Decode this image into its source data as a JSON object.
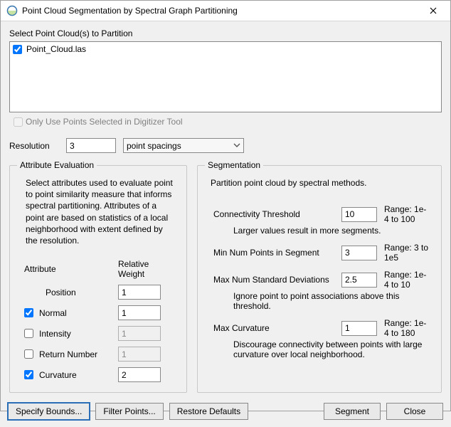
{
  "title": "Point Cloud Segmentation by Spectral Graph Partitioning",
  "select_label": "Select Point Cloud(s) to Partition",
  "clouds": [
    {
      "name": "Point_Cloud.las",
      "checked": true
    }
  ],
  "only_selected": {
    "label": "Only Use Points Selected in Digitizer Tool",
    "checked": false
  },
  "resolution": {
    "label": "Resolution",
    "value": "3",
    "unit_selected": "point spacings"
  },
  "attr_eval": {
    "legend": "Attribute Evaluation",
    "desc": "Select attributes used to evaluate point to point similarity measure that informs spectral partitioning. Attributes of a point are based on statistics of a local neighborhood with extent defined by the resolution.",
    "col_attr": "Attribute",
    "col_wt": "Relative Weight",
    "rows": [
      {
        "label": "Position",
        "has_box": false,
        "checked": true,
        "weight": "1",
        "enabled": true
      },
      {
        "label": "Normal",
        "has_box": true,
        "checked": true,
        "weight": "1",
        "enabled": true
      },
      {
        "label": "Intensity",
        "has_box": true,
        "checked": false,
        "weight": "1",
        "enabled": false
      },
      {
        "label": "Return Number",
        "has_box": true,
        "checked": false,
        "weight": "1",
        "enabled": false
      },
      {
        "label": "Curvature",
        "has_box": true,
        "checked": true,
        "weight": "2",
        "enabled": true
      }
    ]
  },
  "seg": {
    "legend": "Segmentation",
    "desc": "Partition point cloud by spectral methods.",
    "params": {
      "conn": {
        "label": "Connectivity Threshold",
        "value": "10",
        "range": "Range: 1e-4 to 100",
        "hint": "Larger values result in more segments."
      },
      "minpts": {
        "label": "Min Num Points in Segment",
        "value": "3",
        "range": "Range: 3 to 1e5"
      },
      "maxstd": {
        "label": "Max Num Standard Deviations",
        "value": "2.5",
        "range": "Range: 1e-4 to 10",
        "hint": "Ignore point to point associations above this threshold."
      },
      "maxcurv": {
        "label": "Max Curvature",
        "value": "1",
        "range": "Range: 1e-4 to 180",
        "hint": "Discourage connectivity between points with large curvature over local neighborhood."
      }
    }
  },
  "buttons": {
    "bounds": "Specify Bounds...",
    "filter": "Filter Points...",
    "restore": "Restore Defaults",
    "segment": "Segment",
    "close": "Close"
  }
}
